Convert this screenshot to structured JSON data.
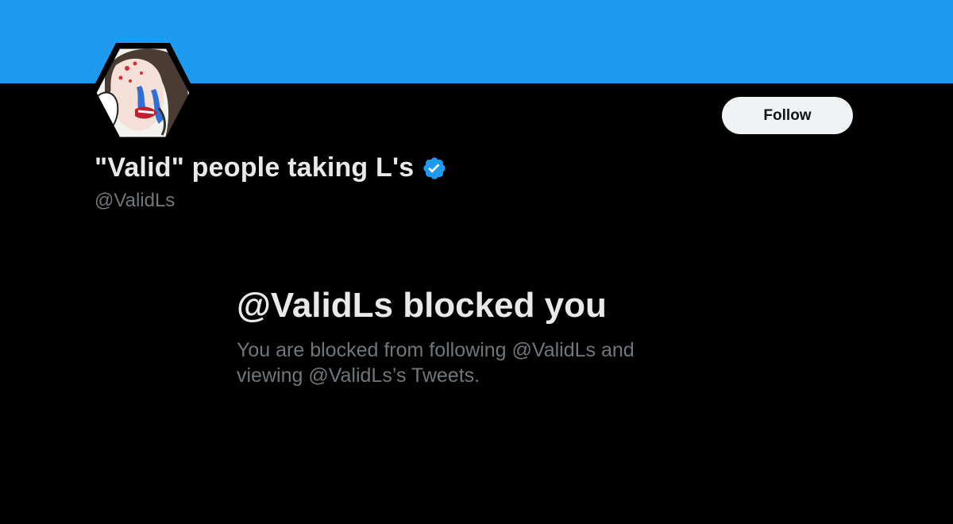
{
  "colors": {
    "banner": "#1D9BF0",
    "background": "#000000",
    "primary_text": "#E7E9EA",
    "secondary_text": "#71767B",
    "follow_button_bg": "#EFF3F4",
    "verified_badge": "#1D9BF0"
  },
  "profile": {
    "display_name": "\"Valid\" people taking L's",
    "handle": "@ValidLs",
    "verified_icon": "verified-badge-icon",
    "avatar_icon": "cartoon-face-avatar"
  },
  "actions": {
    "follow_label": "Follow"
  },
  "blocked": {
    "title": "@ValidLs blocked you",
    "description": "You are blocked from following @ValidLs and viewing @ValidLs’s Tweets."
  }
}
